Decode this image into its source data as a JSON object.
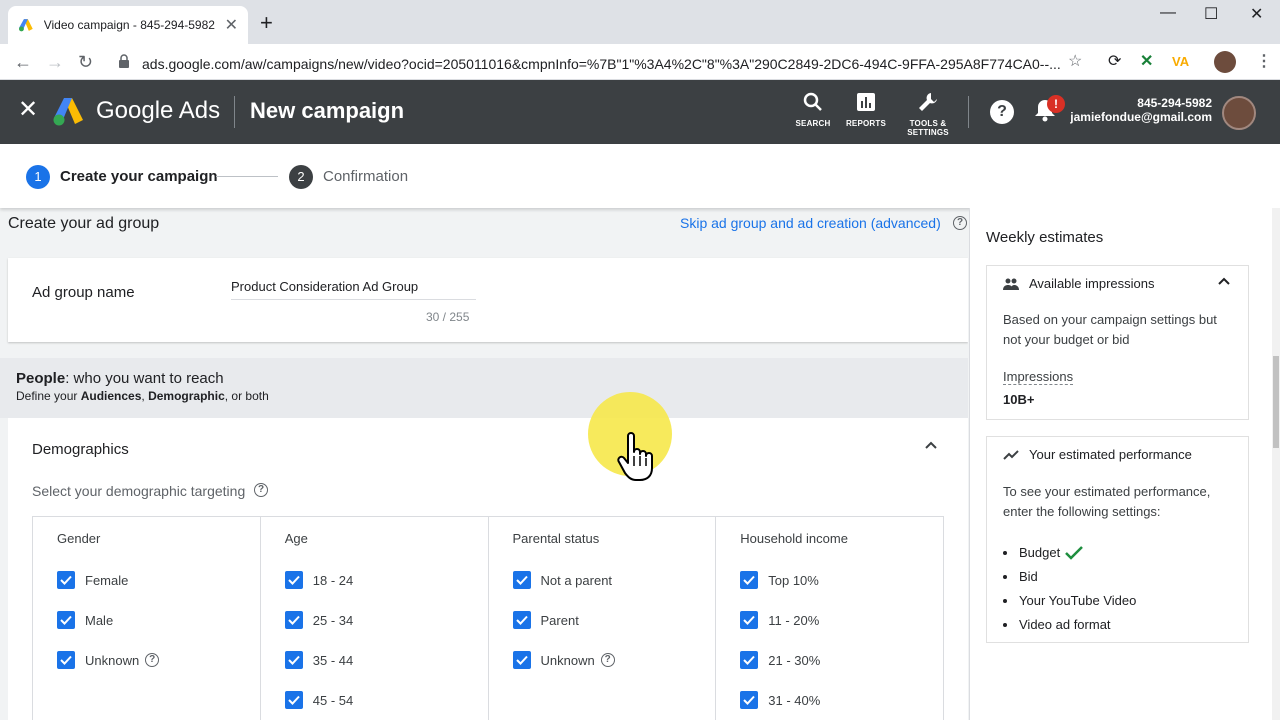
{
  "browser": {
    "tab_title": "Video campaign - 845-294-5982",
    "url": "ads.google.com/aw/campaigns/new/video?ocid=205011016&cmpnInfo=%7B\"1\"%3A4%2C\"8\"%3A\"290C2849-2DC6-494C-9FFA-295A8F774CA0--..."
  },
  "header": {
    "brand": "Google Ads",
    "title": "New campaign",
    "tools": [
      {
        "label": "SEARCH",
        "icon": "search-icon"
      },
      {
        "label": "REPORTS",
        "icon": "reports-icon"
      },
      {
        "label": "TOOLS & SETTINGS",
        "icon": "wrench-icon"
      }
    ],
    "notification_badge": "!",
    "account_id": "845-294-5982",
    "account_email": "jamiefondue@gmail.com"
  },
  "stepper": {
    "steps": [
      {
        "num": "1",
        "label": "Create your campaign",
        "active": true
      },
      {
        "num": "2",
        "label": "Confirmation",
        "active": false
      }
    ]
  },
  "main": {
    "section_title": "Create your ad group",
    "skip_link": "Skip ad group and ad creation (advanced)",
    "ad_group": {
      "label": "Ad group name",
      "value": "Product Consideration Ad Group",
      "counter": "30 / 255"
    },
    "people": {
      "title_bold": "People",
      "title_rest": ": who you want to reach",
      "sub_prefix": "Define your ",
      "sub_bold1": "Audiences",
      "sub_sep": ", ",
      "sub_bold2": "Demographic",
      "sub_suffix": ", or both"
    },
    "demographics": {
      "title": "Demographics",
      "subtitle": "Select your demographic targeting",
      "columns": [
        {
          "header": "Gender",
          "options": [
            "Female",
            "Male",
            "Unknown"
          ]
        },
        {
          "header": "Age",
          "options": [
            "18 - 24",
            "25 - 34",
            "35 - 44",
            "45 - 54"
          ]
        },
        {
          "header": "Parental status",
          "options": [
            "Not a parent",
            "Parent",
            "Unknown"
          ]
        },
        {
          "header": "Household income",
          "options": [
            "Top 10%",
            "11 - 20%",
            "21 - 30%",
            "31 - 40%"
          ]
        }
      ]
    }
  },
  "right_panel": {
    "title": "Weekly estimates",
    "impressions_card": {
      "title": "Available impressions",
      "text": "Based on your campaign settings but not your budget or bid",
      "metric_label": "Impressions",
      "metric_value": "10B+"
    },
    "performance_card": {
      "title": "Your estimated performance",
      "text": "To see your estimated performance, enter the following settings:",
      "items": [
        "Budget",
        "Bid",
        "Your YouTube Video",
        "Video ad format"
      ]
    }
  },
  "colors": {
    "header_bg": "#3c4043",
    "accent_blue": "#1a73e8",
    "check_green": "#1e8e3e",
    "alert_red": "#d93025"
  }
}
